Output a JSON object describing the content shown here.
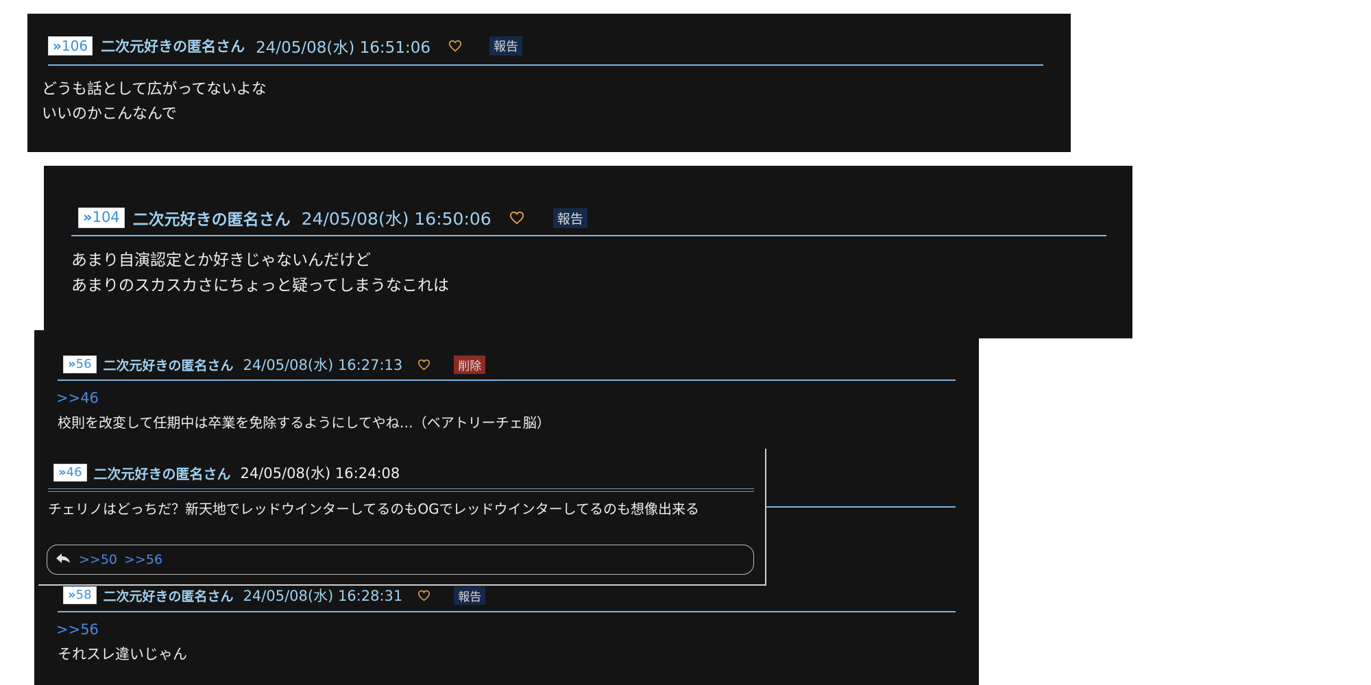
{
  "colors": {
    "panel_bg": "#141414",
    "name_text": "#9fd0f0",
    "rule": "#7fb6e6",
    "anchor_link": "#4d8ae0",
    "heart": "#e6a64a",
    "report_badge": "#15294a",
    "delete_badge": "#8c2b25"
  },
  "posts": {
    "p106": {
      "number": "106",
      "name": "二次元好きの匿名さん",
      "datetime": "24/05/08(水) 16:51:06",
      "badge": "報告",
      "lines": [
        "どうも話として広がってないよな",
        "いいのかこんなんで"
      ]
    },
    "p104": {
      "number": "104",
      "name": "二次元好きの匿名さん",
      "datetime": "24/05/08(水) 16:50:06",
      "badge": "報告",
      "lines": [
        "あまり自演認定とか好きじゃないんだけど",
        "あまりのスカスカさにちょっと疑ってしまうなこれは"
      ]
    },
    "p56": {
      "number": "56",
      "name": "二次元好きの匿名さん",
      "datetime": "24/05/08(水) 16:27:13",
      "badge": "削除",
      "anchor": ">>46",
      "lines": [
        "校則を改変して任期中は卒業を免除するようにしてやね…（ベアトリーチェ脳）"
      ]
    },
    "p46": {
      "number": "46",
      "name": "二次元好きの匿名さん",
      "datetime": "24/05/08(水) 16:24:08",
      "lines": [
        "チェリノはどっちだ？新天地でレッドウインターしてるのもOGでレッドウインターしてるのも想像出来る"
      ],
      "replies": [
        ">>50",
        ">>56"
      ]
    },
    "p58": {
      "number": "58",
      "name": "二次元好きの匿名さん",
      "datetime": "24/05/08(水) 16:28:31",
      "badge": "報告",
      "anchor": ">>56",
      "lines": [
        "それスレ違いじゃん"
      ]
    }
  }
}
